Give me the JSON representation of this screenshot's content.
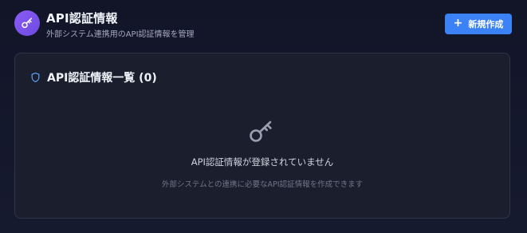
{
  "header": {
    "title": "API認証情報",
    "subtitle": "外部システム連携用のAPI認証情報を管理",
    "new_button": {
      "icon": "plus-icon",
      "label": "新規作成"
    }
  },
  "list": {
    "title": "API認証情報一覧 (0)",
    "count": 0,
    "empty_state": {
      "icon": "key-icon",
      "title": "API認証情報が登録されていません",
      "description": "外部システムとの連携に必要なAPI認証情報を作成できます"
    }
  },
  "colors": {
    "accent": "#3b82f6",
    "app_icon_gradient_start": "#8b5cf6",
    "app_icon_gradient_end": "#6d4ae0",
    "shield_icon": "#60a5fa",
    "background": "#141729",
    "card_background": "#1b1f2d",
    "card_border": "#2e3447"
  },
  "icons": {
    "app": "key-icon",
    "list_header": "shield-icon"
  }
}
